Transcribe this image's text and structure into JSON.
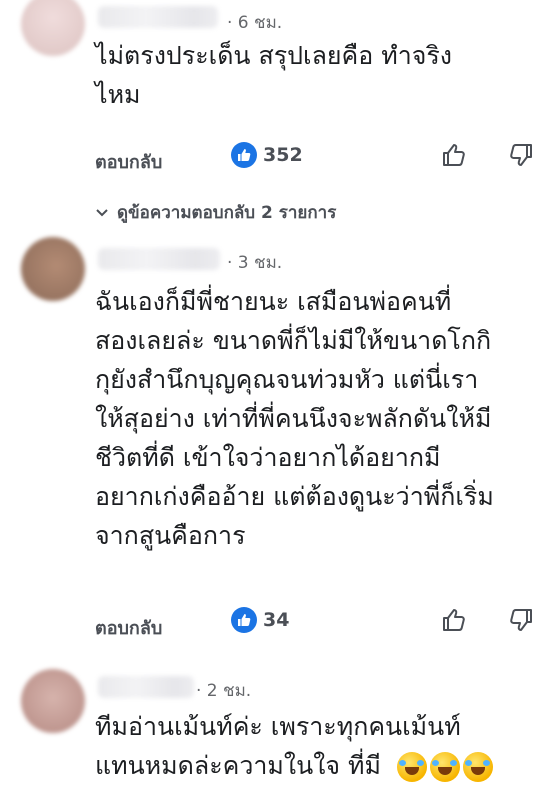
{
  "colors": {
    "accent": "#1b74e4",
    "secondary_text": "#65676b",
    "text": "#1c1e21"
  },
  "comments": [
    {
      "time": "· 6 ชม.",
      "lines": [
        "ไม่ตรงประเด็น สรุปเลยคือ ทำจริง",
        "ไหม"
      ],
      "reply_label": "ตอบกลับ",
      "like_count": "352",
      "view_replies": "ดูข้อความตอบกลับ 2 รายการ",
      "avatar_color": "#e8d3d2"
    },
    {
      "time": "· 3 ชม.",
      "lines": [
        "ฉันเองก็มีพี่ชายนะ เสมือนพ่อคนที่",
        "สองเลยล่ะ ขนาดพี่ก็ไม่มีให้ขนาดโกกิ",
        "กุยังสำนึกบุญคุณจนท่วมหัว แต่นี่เรา",
        "ให้สุอย่าง เท่าที่พี่คนนึงจะพลักดันให้มี",
        "ชีวิตที่ดี เข้าใจว่าอยากได้อยากมี",
        "อยากเก่งคืออ้าย แต่ต้องดูนะว่าพี่ก็เริ่ม",
        "จากสูนคือการ"
      ],
      "reply_label": "ตอบกลับ",
      "like_count": "34",
      "avatar_color": "#a27f6c"
    },
    {
      "time": "· 2 ชม.",
      "lines": [
        "ทีมอ่านเม้นท์ค่ะ  เพราะทุกคนเม้นท์",
        "แทนหมดล่ะความในใจ ที่มี"
      ],
      "emoji": "face-with-tears-of-joy",
      "avatar_color": "#c79f97"
    }
  ]
}
